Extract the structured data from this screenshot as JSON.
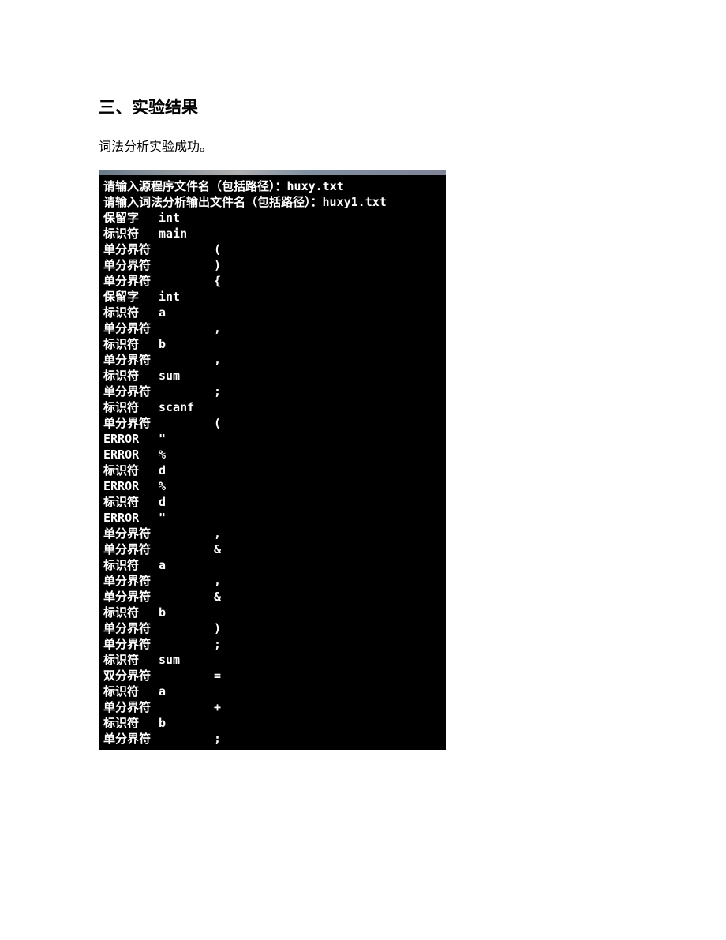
{
  "heading": "三、实验结果",
  "paragraph": "词法分析实验成功。",
  "terminal": {
    "prompt1_label": "请输入源程序文件名（包括路径）：",
    "prompt1_value": "huxy.txt",
    "prompt2_label": "请输入词法分析输出文件名（包括路径）：",
    "prompt2_value": "huxy1.txt",
    "rows": [
      {
        "t": "保留字",
        "v": "int",
        "w": 0
      },
      {
        "t": "标识符",
        "v": "main",
        "w": 0
      },
      {
        "t": "单分界符",
        "v": "(",
        "w": 1
      },
      {
        "t": "单分界符",
        "v": ")",
        "w": 1
      },
      {
        "t": "单分界符",
        "v": "{",
        "w": 1
      },
      {
        "t": "保留字",
        "v": "int",
        "w": 0
      },
      {
        "t": "标识符",
        "v": "a",
        "w": 0
      },
      {
        "t": "单分界符",
        "v": ",",
        "w": 1
      },
      {
        "t": "标识符",
        "v": "b",
        "w": 0
      },
      {
        "t": "单分界符",
        "v": ",",
        "w": 1
      },
      {
        "t": "标识符",
        "v": "sum",
        "w": 0
      },
      {
        "t": "单分界符",
        "v": ";",
        "w": 1
      },
      {
        "t": "标识符",
        "v": "scanf",
        "w": 0
      },
      {
        "t": "单分界符",
        "v": "(",
        "w": 1
      },
      {
        "t": "ERROR",
        "v": "\"",
        "w": 0
      },
      {
        "t": "ERROR",
        "v": "%",
        "w": 0
      },
      {
        "t": "标识符",
        "v": "d",
        "w": 0
      },
      {
        "t": "ERROR",
        "v": "%",
        "w": 0
      },
      {
        "t": "标识符",
        "v": "d",
        "w": 0
      },
      {
        "t": "ERROR",
        "v": "\"",
        "w": 0
      },
      {
        "t": "单分界符",
        "v": ",",
        "w": 1
      },
      {
        "t": "单分界符",
        "v": "&",
        "w": 1
      },
      {
        "t": "标识符",
        "v": "a",
        "w": 0
      },
      {
        "t": "单分界符",
        "v": ",",
        "w": 1
      },
      {
        "t": "单分界符",
        "v": "&",
        "w": 1
      },
      {
        "t": "标识符",
        "v": "b",
        "w": 0
      },
      {
        "t": "单分界符",
        "v": ")",
        "w": 1
      },
      {
        "t": "单分界符",
        "v": ";",
        "w": 1
      },
      {
        "t": "标识符",
        "v": "sum",
        "w": 0
      },
      {
        "t": "双分界符",
        "v": "=",
        "w": 1
      },
      {
        "t": "标识符",
        "v": "a",
        "w": 0
      },
      {
        "t": "单分界符",
        "v": "+",
        "w": 1
      },
      {
        "t": "标识符",
        "v": "b",
        "w": 0
      },
      {
        "t": "单分界符",
        "v": ";",
        "w": 1
      }
    ]
  }
}
